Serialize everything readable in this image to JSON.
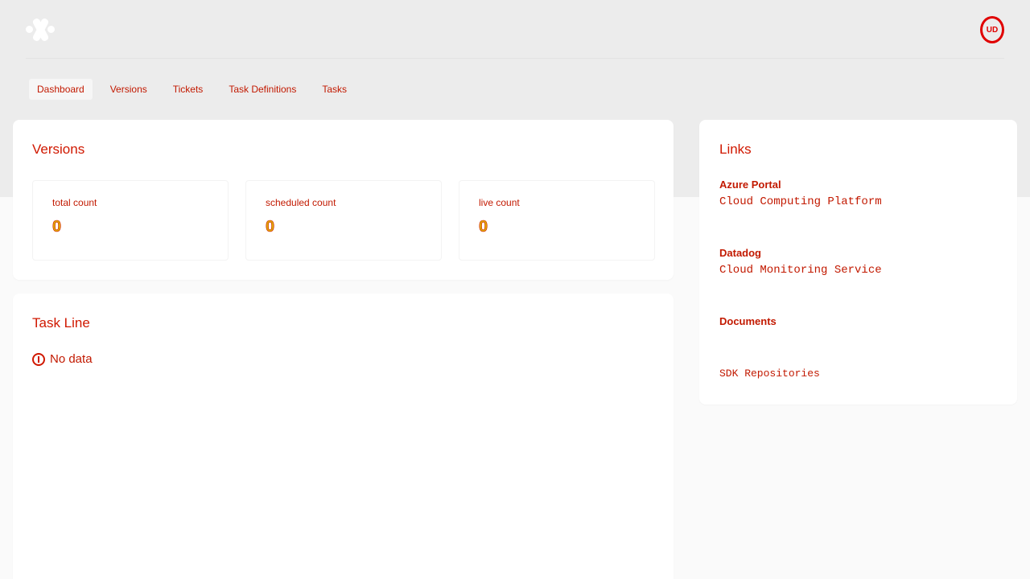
{
  "header": {
    "logo": "app-logo-icon",
    "user_badge": "UD"
  },
  "nav": {
    "items": [
      {
        "label": "Dashboard"
      },
      {
        "label": "Versions"
      },
      {
        "label": "Tickets"
      },
      {
        "label": "Task Definitions"
      },
      {
        "label": "Tasks"
      }
    ]
  },
  "versions": {
    "title": "Versions",
    "stats": [
      {
        "label": "total count",
        "value": "0"
      },
      {
        "label": "scheduled count",
        "value": "0"
      },
      {
        "label": "live count",
        "value": "0"
      }
    ]
  },
  "task_line": {
    "title": "Task Line",
    "empty_text": "No data"
  },
  "links": {
    "title": "Links",
    "groups": [
      {
        "label": "Azure Portal",
        "value": "Cloud Computing Platform"
      },
      {
        "label": "Datadog",
        "value": "Cloud Monitoring Service"
      },
      {
        "label": "Documents",
        "value": ""
      },
      {
        "label": "",
        "value": "SDK Repositories"
      }
    ]
  },
  "colors": {
    "accent": "#d01800",
    "warning": "#e0a800",
    "background": "#ececec"
  }
}
